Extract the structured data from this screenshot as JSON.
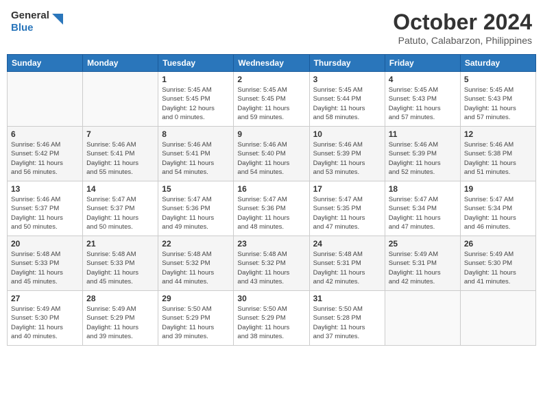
{
  "header": {
    "logo_line1": "General",
    "logo_line2": "Blue",
    "month": "October 2024",
    "location": "Patuto, Calabarzon, Philippines"
  },
  "days_of_week": [
    "Sunday",
    "Monday",
    "Tuesday",
    "Wednesday",
    "Thursday",
    "Friday",
    "Saturday"
  ],
  "weeks": [
    [
      {
        "day": "",
        "info": ""
      },
      {
        "day": "",
        "info": ""
      },
      {
        "day": "1",
        "info": "Sunrise: 5:45 AM\nSunset: 5:45 PM\nDaylight: 12 hours\nand 0 minutes."
      },
      {
        "day": "2",
        "info": "Sunrise: 5:45 AM\nSunset: 5:45 PM\nDaylight: 11 hours\nand 59 minutes."
      },
      {
        "day": "3",
        "info": "Sunrise: 5:45 AM\nSunset: 5:44 PM\nDaylight: 11 hours\nand 58 minutes."
      },
      {
        "day": "4",
        "info": "Sunrise: 5:45 AM\nSunset: 5:43 PM\nDaylight: 11 hours\nand 57 minutes."
      },
      {
        "day": "5",
        "info": "Sunrise: 5:45 AM\nSunset: 5:43 PM\nDaylight: 11 hours\nand 57 minutes."
      }
    ],
    [
      {
        "day": "6",
        "info": "Sunrise: 5:46 AM\nSunset: 5:42 PM\nDaylight: 11 hours\nand 56 minutes."
      },
      {
        "day": "7",
        "info": "Sunrise: 5:46 AM\nSunset: 5:41 PM\nDaylight: 11 hours\nand 55 minutes."
      },
      {
        "day": "8",
        "info": "Sunrise: 5:46 AM\nSunset: 5:41 PM\nDaylight: 11 hours\nand 54 minutes."
      },
      {
        "day": "9",
        "info": "Sunrise: 5:46 AM\nSunset: 5:40 PM\nDaylight: 11 hours\nand 54 minutes."
      },
      {
        "day": "10",
        "info": "Sunrise: 5:46 AM\nSunset: 5:39 PM\nDaylight: 11 hours\nand 53 minutes."
      },
      {
        "day": "11",
        "info": "Sunrise: 5:46 AM\nSunset: 5:39 PM\nDaylight: 11 hours\nand 52 minutes."
      },
      {
        "day": "12",
        "info": "Sunrise: 5:46 AM\nSunset: 5:38 PM\nDaylight: 11 hours\nand 51 minutes."
      }
    ],
    [
      {
        "day": "13",
        "info": "Sunrise: 5:46 AM\nSunset: 5:37 PM\nDaylight: 11 hours\nand 50 minutes."
      },
      {
        "day": "14",
        "info": "Sunrise: 5:47 AM\nSunset: 5:37 PM\nDaylight: 11 hours\nand 50 minutes."
      },
      {
        "day": "15",
        "info": "Sunrise: 5:47 AM\nSunset: 5:36 PM\nDaylight: 11 hours\nand 49 minutes."
      },
      {
        "day": "16",
        "info": "Sunrise: 5:47 AM\nSunset: 5:36 PM\nDaylight: 11 hours\nand 48 minutes."
      },
      {
        "day": "17",
        "info": "Sunrise: 5:47 AM\nSunset: 5:35 PM\nDaylight: 11 hours\nand 47 minutes."
      },
      {
        "day": "18",
        "info": "Sunrise: 5:47 AM\nSunset: 5:34 PM\nDaylight: 11 hours\nand 47 minutes."
      },
      {
        "day": "19",
        "info": "Sunrise: 5:47 AM\nSunset: 5:34 PM\nDaylight: 11 hours\nand 46 minutes."
      }
    ],
    [
      {
        "day": "20",
        "info": "Sunrise: 5:48 AM\nSunset: 5:33 PM\nDaylight: 11 hours\nand 45 minutes."
      },
      {
        "day": "21",
        "info": "Sunrise: 5:48 AM\nSunset: 5:33 PM\nDaylight: 11 hours\nand 45 minutes."
      },
      {
        "day": "22",
        "info": "Sunrise: 5:48 AM\nSunset: 5:32 PM\nDaylight: 11 hours\nand 44 minutes."
      },
      {
        "day": "23",
        "info": "Sunrise: 5:48 AM\nSunset: 5:32 PM\nDaylight: 11 hours\nand 43 minutes."
      },
      {
        "day": "24",
        "info": "Sunrise: 5:48 AM\nSunset: 5:31 PM\nDaylight: 11 hours\nand 42 minutes."
      },
      {
        "day": "25",
        "info": "Sunrise: 5:49 AM\nSunset: 5:31 PM\nDaylight: 11 hours\nand 42 minutes."
      },
      {
        "day": "26",
        "info": "Sunrise: 5:49 AM\nSunset: 5:30 PM\nDaylight: 11 hours\nand 41 minutes."
      }
    ],
    [
      {
        "day": "27",
        "info": "Sunrise: 5:49 AM\nSunset: 5:30 PM\nDaylight: 11 hours\nand 40 minutes."
      },
      {
        "day": "28",
        "info": "Sunrise: 5:49 AM\nSunset: 5:29 PM\nDaylight: 11 hours\nand 39 minutes."
      },
      {
        "day": "29",
        "info": "Sunrise: 5:50 AM\nSunset: 5:29 PM\nDaylight: 11 hours\nand 39 minutes."
      },
      {
        "day": "30",
        "info": "Sunrise: 5:50 AM\nSunset: 5:29 PM\nDaylight: 11 hours\nand 38 minutes."
      },
      {
        "day": "31",
        "info": "Sunrise: 5:50 AM\nSunset: 5:28 PM\nDaylight: 11 hours\nand 37 minutes."
      },
      {
        "day": "",
        "info": ""
      },
      {
        "day": "",
        "info": ""
      }
    ]
  ]
}
